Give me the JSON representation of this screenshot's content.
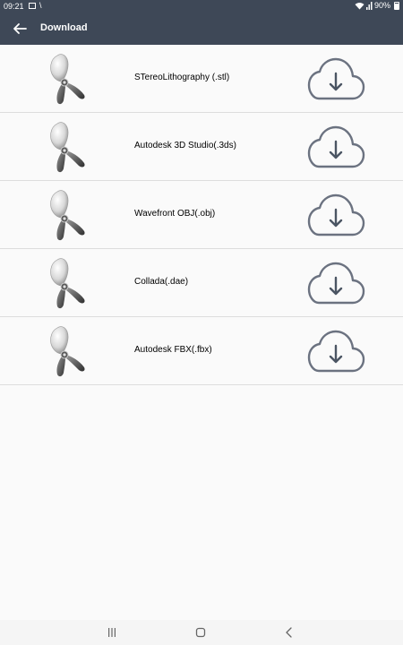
{
  "status": {
    "time": "09:21",
    "battery": "90%"
  },
  "header": {
    "title": "Download"
  },
  "items": [
    {
      "label": "STereoLithography (.stl)"
    },
    {
      "label": "Autodesk 3D Studio(.3ds)"
    },
    {
      "label": "Wavefront OBJ(.obj)"
    },
    {
      "label": "Collada(.dae)"
    },
    {
      "label": "Autodesk FBX(.fbx)"
    }
  ],
  "colors": {
    "app_bar": "#3e4857",
    "background": "#fafafa",
    "divider": "#dddddd",
    "cloud": "#6b7280"
  },
  "icons": {
    "back": "arrow-left-icon",
    "download": "cloud-download-icon",
    "thumb": "propeller-icon"
  }
}
